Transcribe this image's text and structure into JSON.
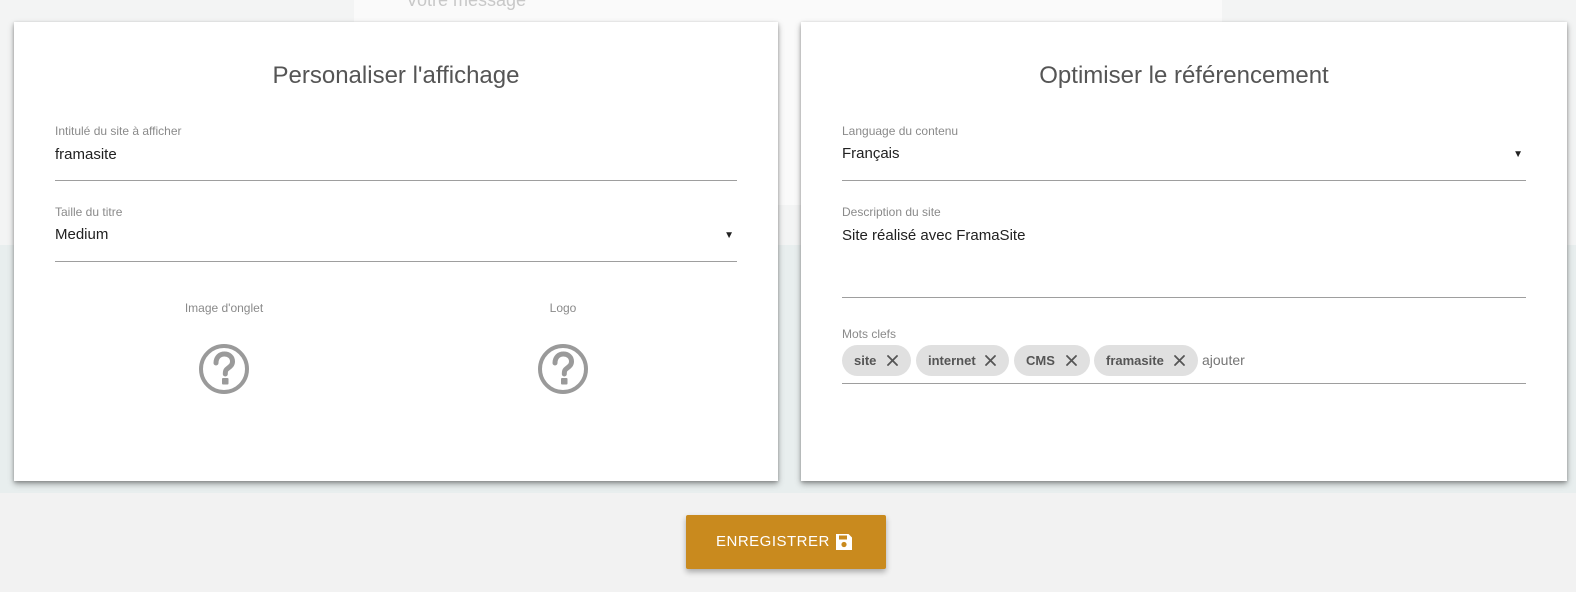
{
  "background": {
    "message_placeholder": "Votre message"
  },
  "display_card": {
    "title": "Personaliser l'affichage",
    "site_title_field": {
      "label": "Intitulé du site à afficher",
      "value": "framasite"
    },
    "title_size_field": {
      "label": "Taille du titre",
      "selected": "Medium"
    },
    "favicon_upload": {
      "label": "Image d'onglet",
      "icon": "question-circle-icon"
    },
    "logo_upload": {
      "label": "Logo",
      "icon": "question-circle-icon"
    }
  },
  "seo_card": {
    "title": "Optimiser le référencement",
    "language_field": {
      "label": "Language du contenu",
      "selected": "Français"
    },
    "description_field": {
      "label": "Description du site",
      "value": "Site réalisé avec FramaSite"
    },
    "keywords_field": {
      "label": "Mots clefs",
      "chips": [
        "site",
        "internet",
        "CMS",
        "framasite"
      ],
      "placeholder": "ajouter"
    }
  },
  "save_button": {
    "label": "ENREGISTRER",
    "icon": "floppy-disk-icon"
  },
  "colors": {
    "accent": "#c98a1e",
    "chip_bg": "#e0e0e0",
    "title_text": "#555555"
  }
}
